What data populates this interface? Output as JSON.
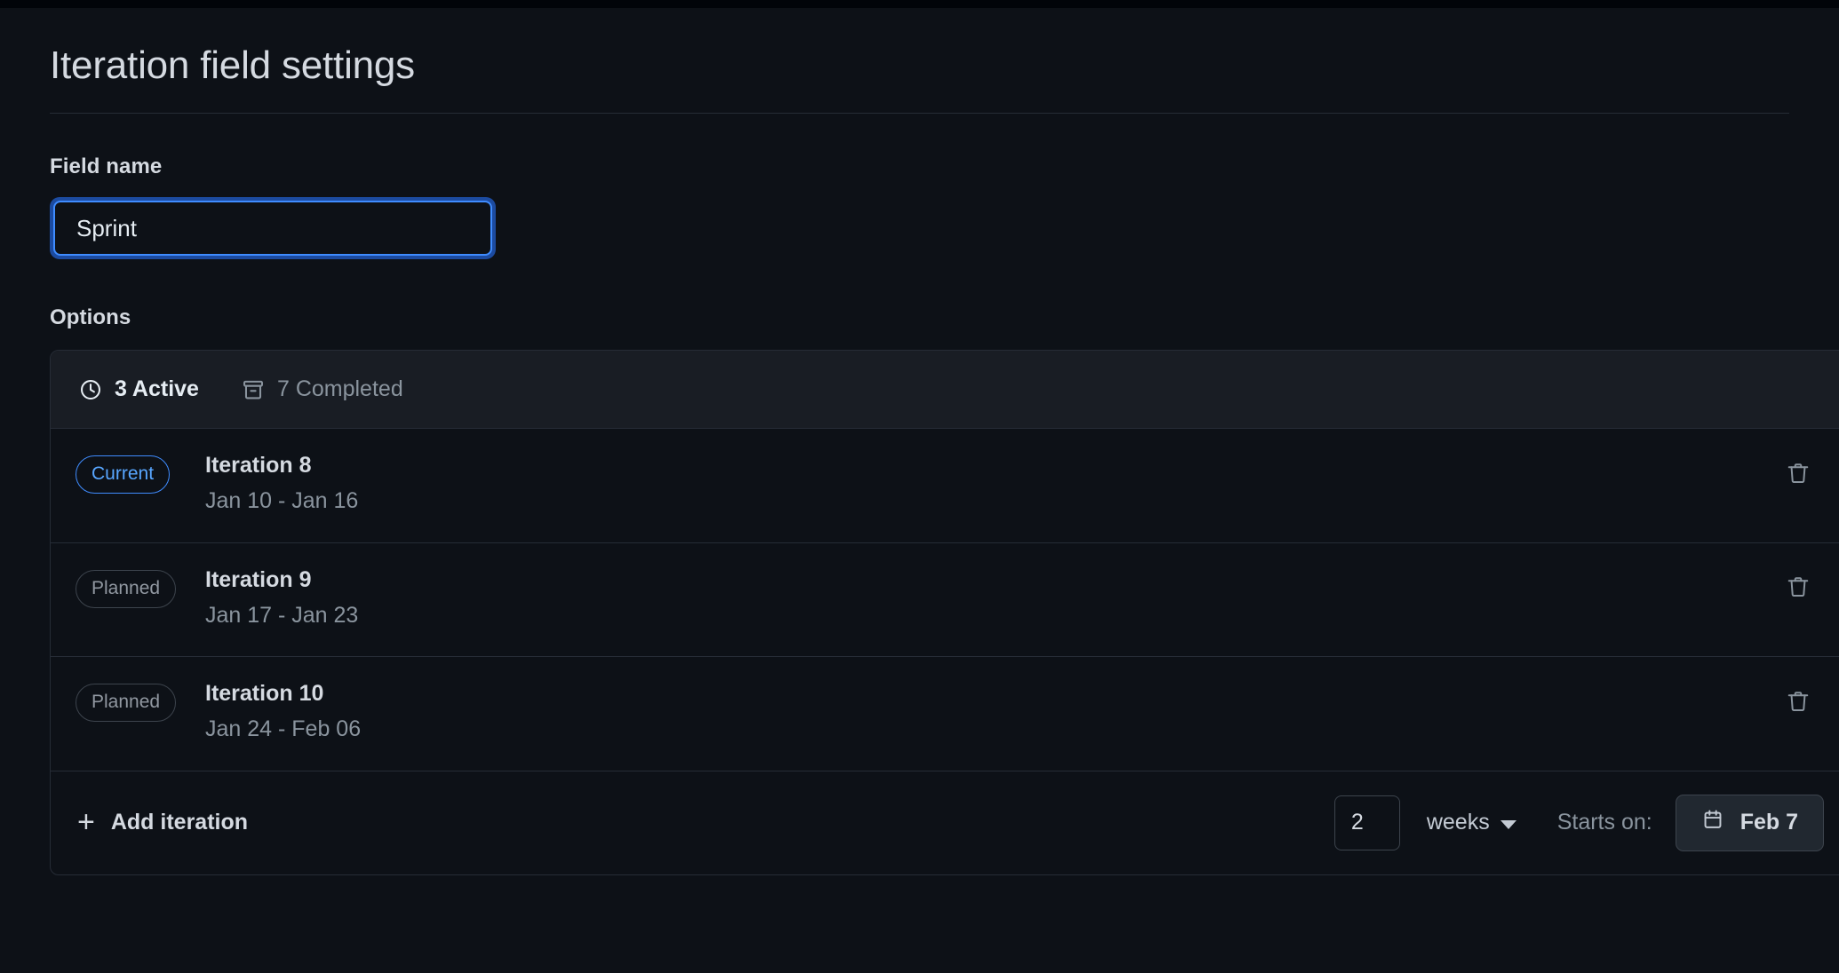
{
  "page": {
    "title": "Iteration field settings"
  },
  "field_name": {
    "label": "Field name",
    "value": "Sprint",
    "placeholder": "Field name"
  },
  "options": {
    "label": "Options",
    "tabs": [
      {
        "label": "3 Active",
        "icon": "clock-icon",
        "active": true
      },
      {
        "label": "7 Completed",
        "icon": "archive-icon",
        "active": false
      }
    ],
    "iterations": [
      {
        "badge": "Current",
        "state": "current",
        "title": "Iteration 8",
        "dates": "Jan 10 - Jan 16",
        "delete_icon": "trash-icon"
      },
      {
        "badge": "Planned",
        "state": "planned",
        "title": "Iteration 9",
        "dates": "Jan 17 - Jan 23",
        "delete_icon": "trash-icon"
      },
      {
        "badge": "Planned",
        "state": "planned",
        "title": "Iteration 10",
        "dates": "Jan 24 - Feb 06",
        "delete_icon": "trash-icon"
      }
    ],
    "footer": {
      "add_label": "Add iteration",
      "add_icon": "plus-icon",
      "duration_value": "2",
      "duration_unit": "weeks",
      "duration_unit_icon": "chevron-down-icon",
      "starts_on_label": "Starts on:",
      "start_date": "Feb 7",
      "calendar_icon": "calendar-icon"
    }
  },
  "colors": {
    "page_bg": "#0d1117",
    "panel_header_bg": "#191d24",
    "border": "#262c36",
    "accent_blue": "#58a6ff",
    "focus_ring": "#1c4ba0",
    "text_primary": "#d5dae1",
    "text_muted": "#8a949e"
  }
}
